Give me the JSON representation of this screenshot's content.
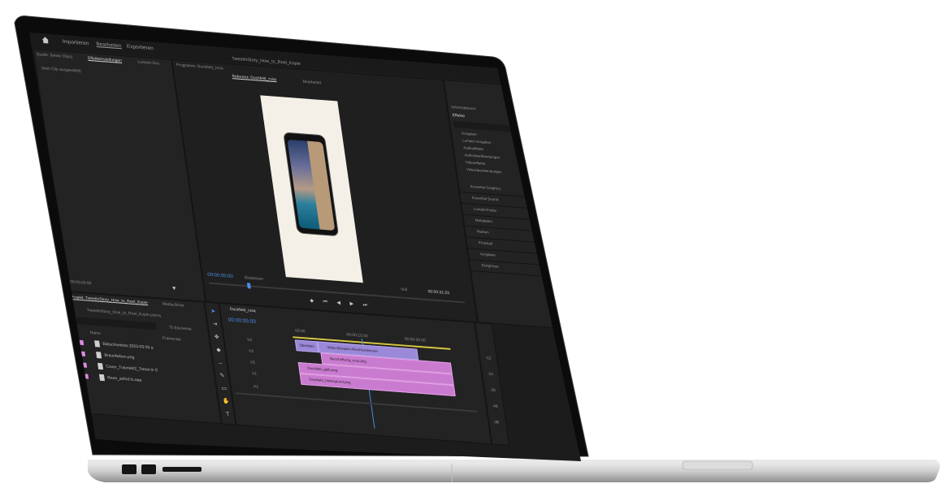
{
  "topbar": {
    "home_icon": "home-icon",
    "tabs": [
      "Importieren",
      "Bearbeiten",
      "Exportieren"
    ],
    "active_tab": "Bearbeiten",
    "sequence_title": "TweetInStory_How_to_Reel_Kopie",
    "sequence_state": "Bearbeitet"
  },
  "source_panel": {
    "tabs": [
      "Quelle: (keine Clips)",
      "Effekteinstellungen",
      "Lumetri-Sco"
    ],
    "empty_text": "(kein Clip ausgewählt)",
    "timecode": "00:00:00:00"
  },
  "program_panel": {
    "tabs": [
      "Programm: Dockfeld_rosa",
      "Referenz: Dockfeld_rosa"
    ],
    "timecode": "00:00:05:00",
    "fit": "Einpassen",
    "quality": "Voll",
    "duration": "00:00:31:23"
  },
  "right_panel": {
    "info_label": "Informationen",
    "effects_label": "Effekte",
    "effect_folders": [
      "Vorgaben",
      "Lumetri-Vorgaben",
      "Audioeffekte",
      "Audioüberblendungen",
      "Videoeffekte",
      "Videoüberblendungen"
    ],
    "workspaces": [
      "Essential Graphics",
      "Essential Sound",
      "Lumetri-Farbe",
      "Metadaten",
      "Marken",
      "Protokoll",
      "Vorgaben",
      "Ereignisse"
    ]
  },
  "project_panel": {
    "title": "Projekt: TweetInStory_How_to_Reel_Kopie",
    "media_tab": "Media-Brow",
    "file_name": "TweetInStory_How_to_Reel_Kopie.prproj",
    "count": "75 Elemente",
    "col_name": "Name",
    "col_framerate": "Framerate",
    "items": [
      "Bildschirmfoto 2023-03-03 a",
      "Braunfarben.png",
      "Cover_Tutorial#2_Tweet in S",
      "Reee_asfnd.fu.aaa"
    ]
  },
  "timeline": {
    "tab": "Dockfeld_rosa",
    "timecode": "00:00:05:00",
    "ruler": [
      "00:00",
      "00:00:15:00",
      "00:00:30:00"
    ],
    "tracks": [
      "V4",
      "V3",
      "V2",
      "V1",
      "A1"
    ],
    "clips": [
      {
        "label": "Überblen",
        "type": "purple"
      },
      {
        "label": "Video-Beispiel-Abschlusslernen",
        "type": "purple"
      },
      {
        "label": "Beschriftung_rosa.png",
        "type": "orange"
      },
      {
        "label": "Dockfeld_gelb.png",
        "type": "pink"
      },
      {
        "label": "Dockfeld_hintergrund.png",
        "type": "pink"
      }
    ]
  },
  "meter_labels": [
    "-12",
    "-24",
    "-36",
    "-48",
    "dB"
  ],
  "colors": {
    "accent": "#4a8fe7",
    "clip_pink": "#c97ccf",
    "clip_purple": "#9a88d8",
    "bg": "#1c1c1c"
  }
}
